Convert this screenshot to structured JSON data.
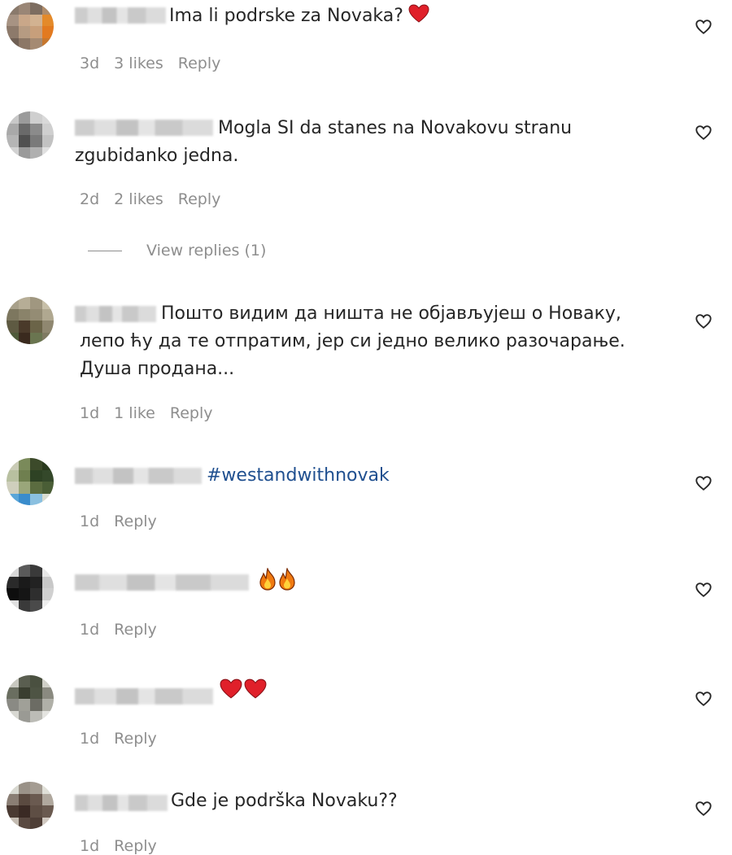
{
  "comments": [
    {
      "text": "Ima li podrske za Novaka?",
      "time": "3d",
      "likes": "3 likes",
      "reply": "Reply"
    },
    {
      "text_line1": "Mogla SI da stanes na Novakovu stranu",
      "text_line2": "zgubidanko jedna.",
      "time": "2d",
      "likes": "2 likes",
      "reply": "Reply",
      "view_replies": "View replies (1)"
    },
    {
      "text_line1": "Пошто видим да ништа не објављујеш о Новаку,",
      "text_line2": "лепо ћу да те отпратим, јер си једно велико разочарање.",
      "text_line3": "Душа продана...",
      "time": "1d",
      "likes": "1 like",
      "reply": "Reply"
    },
    {
      "text": "#westandwithnovak",
      "time": "1d",
      "reply": "Reply"
    },
    {
      "time": "1d",
      "reply": "Reply"
    },
    {
      "time": "1d",
      "reply": "Reply"
    },
    {
      "text": "Gde je podrška Novaku??",
      "time": "1d",
      "reply": "Reply"
    }
  ],
  "icons": {
    "like": "heart-outline-icon",
    "emoji_heart": "red-heart-emoji",
    "emoji_fire": "fire-emoji"
  },
  "colors": {
    "hashtag": "#1f4f8f",
    "meta": "#8e8e8e",
    "heart_emoji": "#e0202a"
  }
}
